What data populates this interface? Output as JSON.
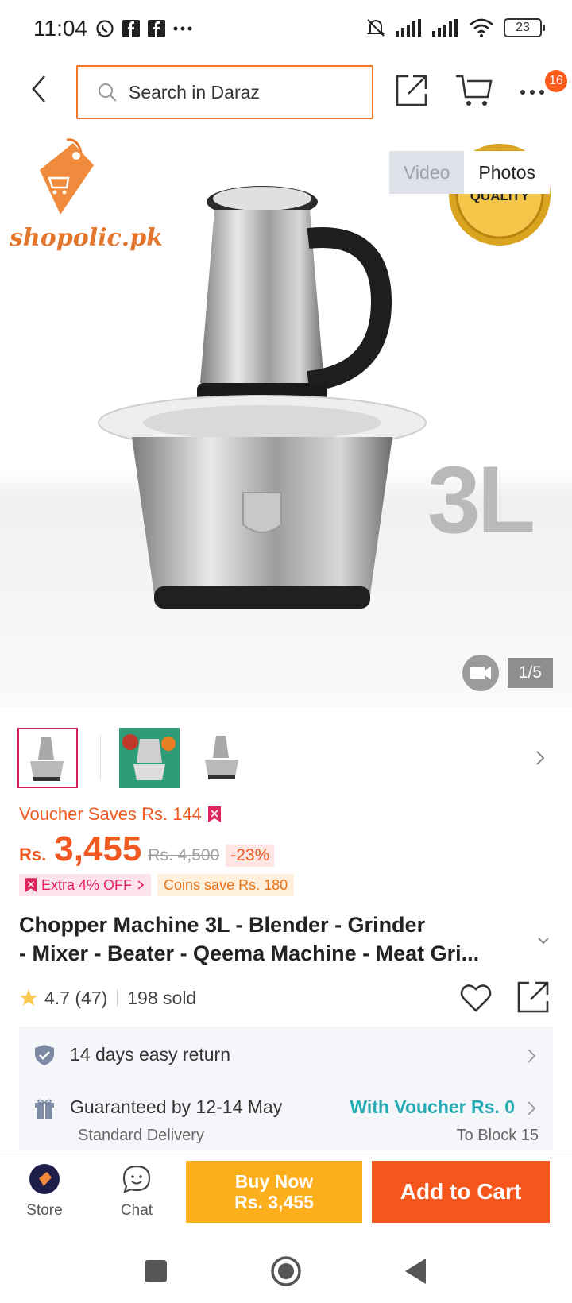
{
  "status_bar": {
    "time": "11:04",
    "battery": "23",
    "icons": [
      "whatsapp-icon",
      "facebook-icon",
      "facebook-icon",
      "more-dots-icon",
      "mute-icon",
      "signal-icon",
      "signal-icon",
      "wifi-icon",
      "battery-icon"
    ]
  },
  "header": {
    "search_placeholder": "Search in Daraz",
    "notification_count": "16"
  },
  "gallery": {
    "tabs": [
      "Video",
      "Photos"
    ],
    "active_tab": "Photos",
    "counter": "1/5",
    "seller_logo_text": "shopolic.pk",
    "badge_text": "QUALITY",
    "image_overlay_text": "3L"
  },
  "pricing": {
    "voucher_saves": "Voucher Saves Rs. 144",
    "currency": "Rs.",
    "price": "3,455",
    "original_price": "Rs. 4,500",
    "discount": "-23%",
    "extra_off": "Extra 4% OFF",
    "coins_save": "Coins save Rs. 180"
  },
  "product": {
    "title_line1": "Chopper Machine 3L - Blender - Grinder",
    "title_line2": "- Mixer - Beater - Qeema Machine - Meat Gri...",
    "rating": "4.7 (47)",
    "sold": "198 sold"
  },
  "service": {
    "return_text": "14 days easy return",
    "delivery_text": "Guaranteed by 12-14 May",
    "delivery_voucher": "With Voucher Rs. 0",
    "delivery_type": "Standard Delivery",
    "delivery_location": "To Block 15"
  },
  "actions": {
    "store_label": "Store",
    "chat_label": "Chat",
    "buy_now_line1": "Buy Now",
    "buy_now_line2": "Rs. 3,455",
    "add_to_cart": "Add to Cart"
  },
  "colors": {
    "accent": "#f57224",
    "price": "#f05a22",
    "buy_now": "#fdae1c",
    "add_to_cart": "#f6561c",
    "teal": "#26abb4"
  }
}
